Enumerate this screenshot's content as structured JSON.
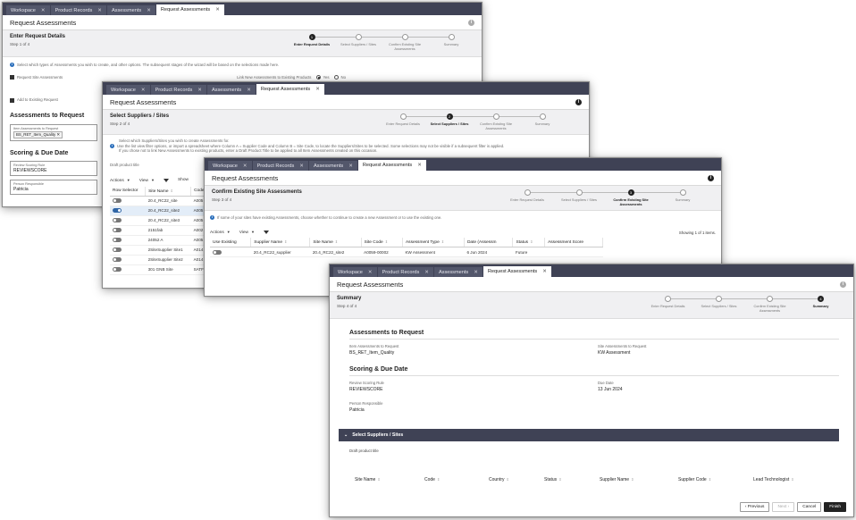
{
  "tabs": {
    "workspace": "Workspace",
    "product_records": "Product Records",
    "assessments": "Assessments",
    "request_assessments": "Request Assessments"
  },
  "page_title": "Request Assessments",
  "steps": [
    "Enter Request Details",
    "Select Suppliers / Sites",
    "Confirm Existing Site Assessments",
    "Summary"
  ],
  "w1": {
    "header": "Enter Request Details",
    "step": "Step 1 of 4",
    "info": "Select which types of Assessments you wish to create, and other options. The subsequent stages of the wizard will be based on the selections made here.",
    "request_site": "Request Site Assessments",
    "link_label": "Link New Assessments to Existing Products",
    "yes": "Yes",
    "no": "No",
    "add_existing": "Add to Existing Request",
    "assess_title": "Assessments to Request",
    "item_label": "Item Assessments to Request",
    "item_chip": "BS_RET_Item_Quality",
    "scoring_title": "Scoring & Due Date",
    "scoring_label": "Review Scoring Rule",
    "scoring_value": "REVIEWSCORE",
    "person_label": "Person Responsible",
    "person_value": "Patricia"
  },
  "w2": {
    "header": "Select Suppliers / Sites",
    "step": "Step 2 of 4",
    "info1": "Select which Suppliers/Sites you wish to create Assessments for.",
    "info2": "Use the list view filter options, or import a spreadsheet where Column A = Supplier Code and Column B = Site Code, to locate the Suppliers/Sites to be selected. Some selections may not be visible if a subsequent filter is applied.",
    "info3": "If you chose not to link New Assessments to existing products, enter a Draft Product Title to be applied to all Item Assessments created on this occasion.",
    "draft_label": "Draft product title",
    "actions": "Actions",
    "view": "View",
    "show": "Show",
    "col_sel": "Row Selector",
    "col_site": "Site Name",
    "col_code": "Code",
    "rows": [
      {
        "site": "20.4_RC22_site",
        "code": "A005"
      },
      {
        "site": "20.4_RC22_site2",
        "code": "A005"
      },
      {
        "site": "20.4_RC22_site3",
        "code": "A005"
      },
      {
        "site": "2151fab",
        "code": "A002"
      },
      {
        "site": "24052 A",
        "code": "A005"
      },
      {
        "site": "2SiteSupplier Site1",
        "code": "A014"
      },
      {
        "site": "2SiteSupplier Site2",
        "code": "A014"
      },
      {
        "site": "301 GNB Site",
        "code": "SATF"
      }
    ]
  },
  "w3": {
    "header": "Confirm Existing Site Assessments",
    "step": "Step 3 of 4",
    "info": "If some of your sites have existing Assessments, choose whether to continue to create a new Assessment or to use the existing one.",
    "actions": "Actions",
    "view": "View",
    "showing": "Showing 1 of 1 items.",
    "cols": [
      "Use Existing",
      "Supplier Name",
      "Site Name",
      "Site Code",
      "Assessment Type",
      "Date (Assessm",
      "Status",
      "Assessment Score"
    ],
    "row": {
      "supplier": "20.4_RC22_supplier",
      "site": "20.4_RC22_site2",
      "code": "A0059-00002",
      "type": "KW Assessment",
      "date": "6 Jun 2024",
      "status": "Future"
    }
  },
  "w4": {
    "header": "Summary",
    "step": "Step 4 of 4",
    "assess_title": "Assessments to Request",
    "item_label": "Item Assessments to Request",
    "item_value": "BS_RET_Item_Quality",
    "site_label": "Site Assessments to Request",
    "site_value": "KW Assessment",
    "scoring_title": "Scoring & Due Date",
    "rule_label": "Review Scoring Rule",
    "rule_value": "REVIEWSCORE",
    "due_label": "Due Date",
    "due_value": "13 Jun 2024",
    "person_label": "Person Responsible",
    "person_value": "Patricia",
    "section_bar": "Select Suppliers / Sites",
    "draft_label": "Draft product title",
    "cols": [
      "Site Name",
      "Code",
      "Country",
      "Status",
      "Supplier Name",
      "Supplier Code",
      "Lead Technologist"
    ],
    "previous": "Previous",
    "next": "Next",
    "cancel": "Cancel",
    "finish": "Finish"
  }
}
